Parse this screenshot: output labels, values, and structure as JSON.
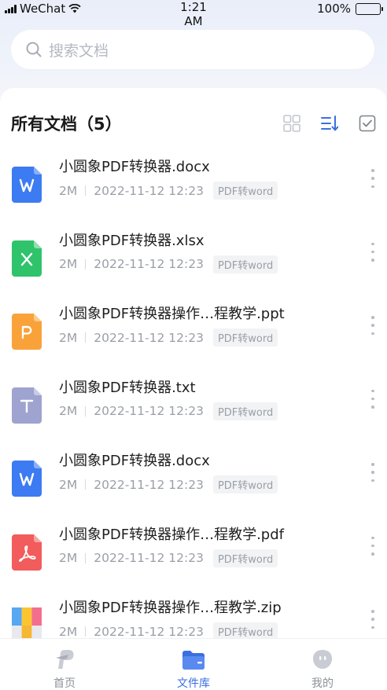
{
  "status_bar": {
    "carrier": "WeChat",
    "time_line1": "1:21",
    "time_line2": "AM",
    "battery": "100%"
  },
  "search": {
    "placeholder": "搜索文档"
  },
  "header": {
    "title": "所有文档（5）"
  },
  "files": [
    {
      "name": "小圆象PDF转换器.docx",
      "size": "2M",
      "date": "2022-11-12 12:23",
      "tag": "PDF转word",
      "type": "word"
    },
    {
      "name": "小圆象PDF转换器.xlsx",
      "size": "2M",
      "date": "2022-11-12 12:23",
      "tag": "PDF转word",
      "type": "excel"
    },
    {
      "name": "小圆象PDF转换器操作…程教学.ppt",
      "size": "2M",
      "date": "2022-11-12 12:23",
      "tag": "PDF转word",
      "type": "ppt"
    },
    {
      "name": "小圆象PDF转换器.txt",
      "size": "2M",
      "date": "2022-11-12 12:23",
      "tag": "PDF转word",
      "type": "txt"
    },
    {
      "name": "小圆象PDF转换器.docx",
      "size": "2M",
      "date": "2022-11-12 12:23",
      "tag": "PDF转word",
      "type": "word"
    },
    {
      "name": "小圆象PDF转换器操作…程教学.pdf",
      "size": "2M",
      "date": "2022-11-12 12:23",
      "tag": "PDF转word",
      "type": "pdf"
    },
    {
      "name": "小圆象PDF转换器操作…程教学.zip",
      "size": "2M",
      "date": "2022-11-12 12:23",
      "tag": "PDF转word",
      "type": "zip"
    }
  ],
  "tabs": [
    {
      "label": "首页",
      "icon": "home-logo-icon",
      "active": false
    },
    {
      "label": "文件库",
      "icon": "folder-icon",
      "active": true
    },
    {
      "label": "我的",
      "icon": "profile-icon",
      "active": false
    }
  ],
  "colors": {
    "accent": "#3b6fe0",
    "word": "#3d7bf2",
    "excel": "#2fc36b",
    "ppt": "#f9a23a",
    "txt": "#9ea3cf",
    "pdf": "#f25c5c"
  }
}
